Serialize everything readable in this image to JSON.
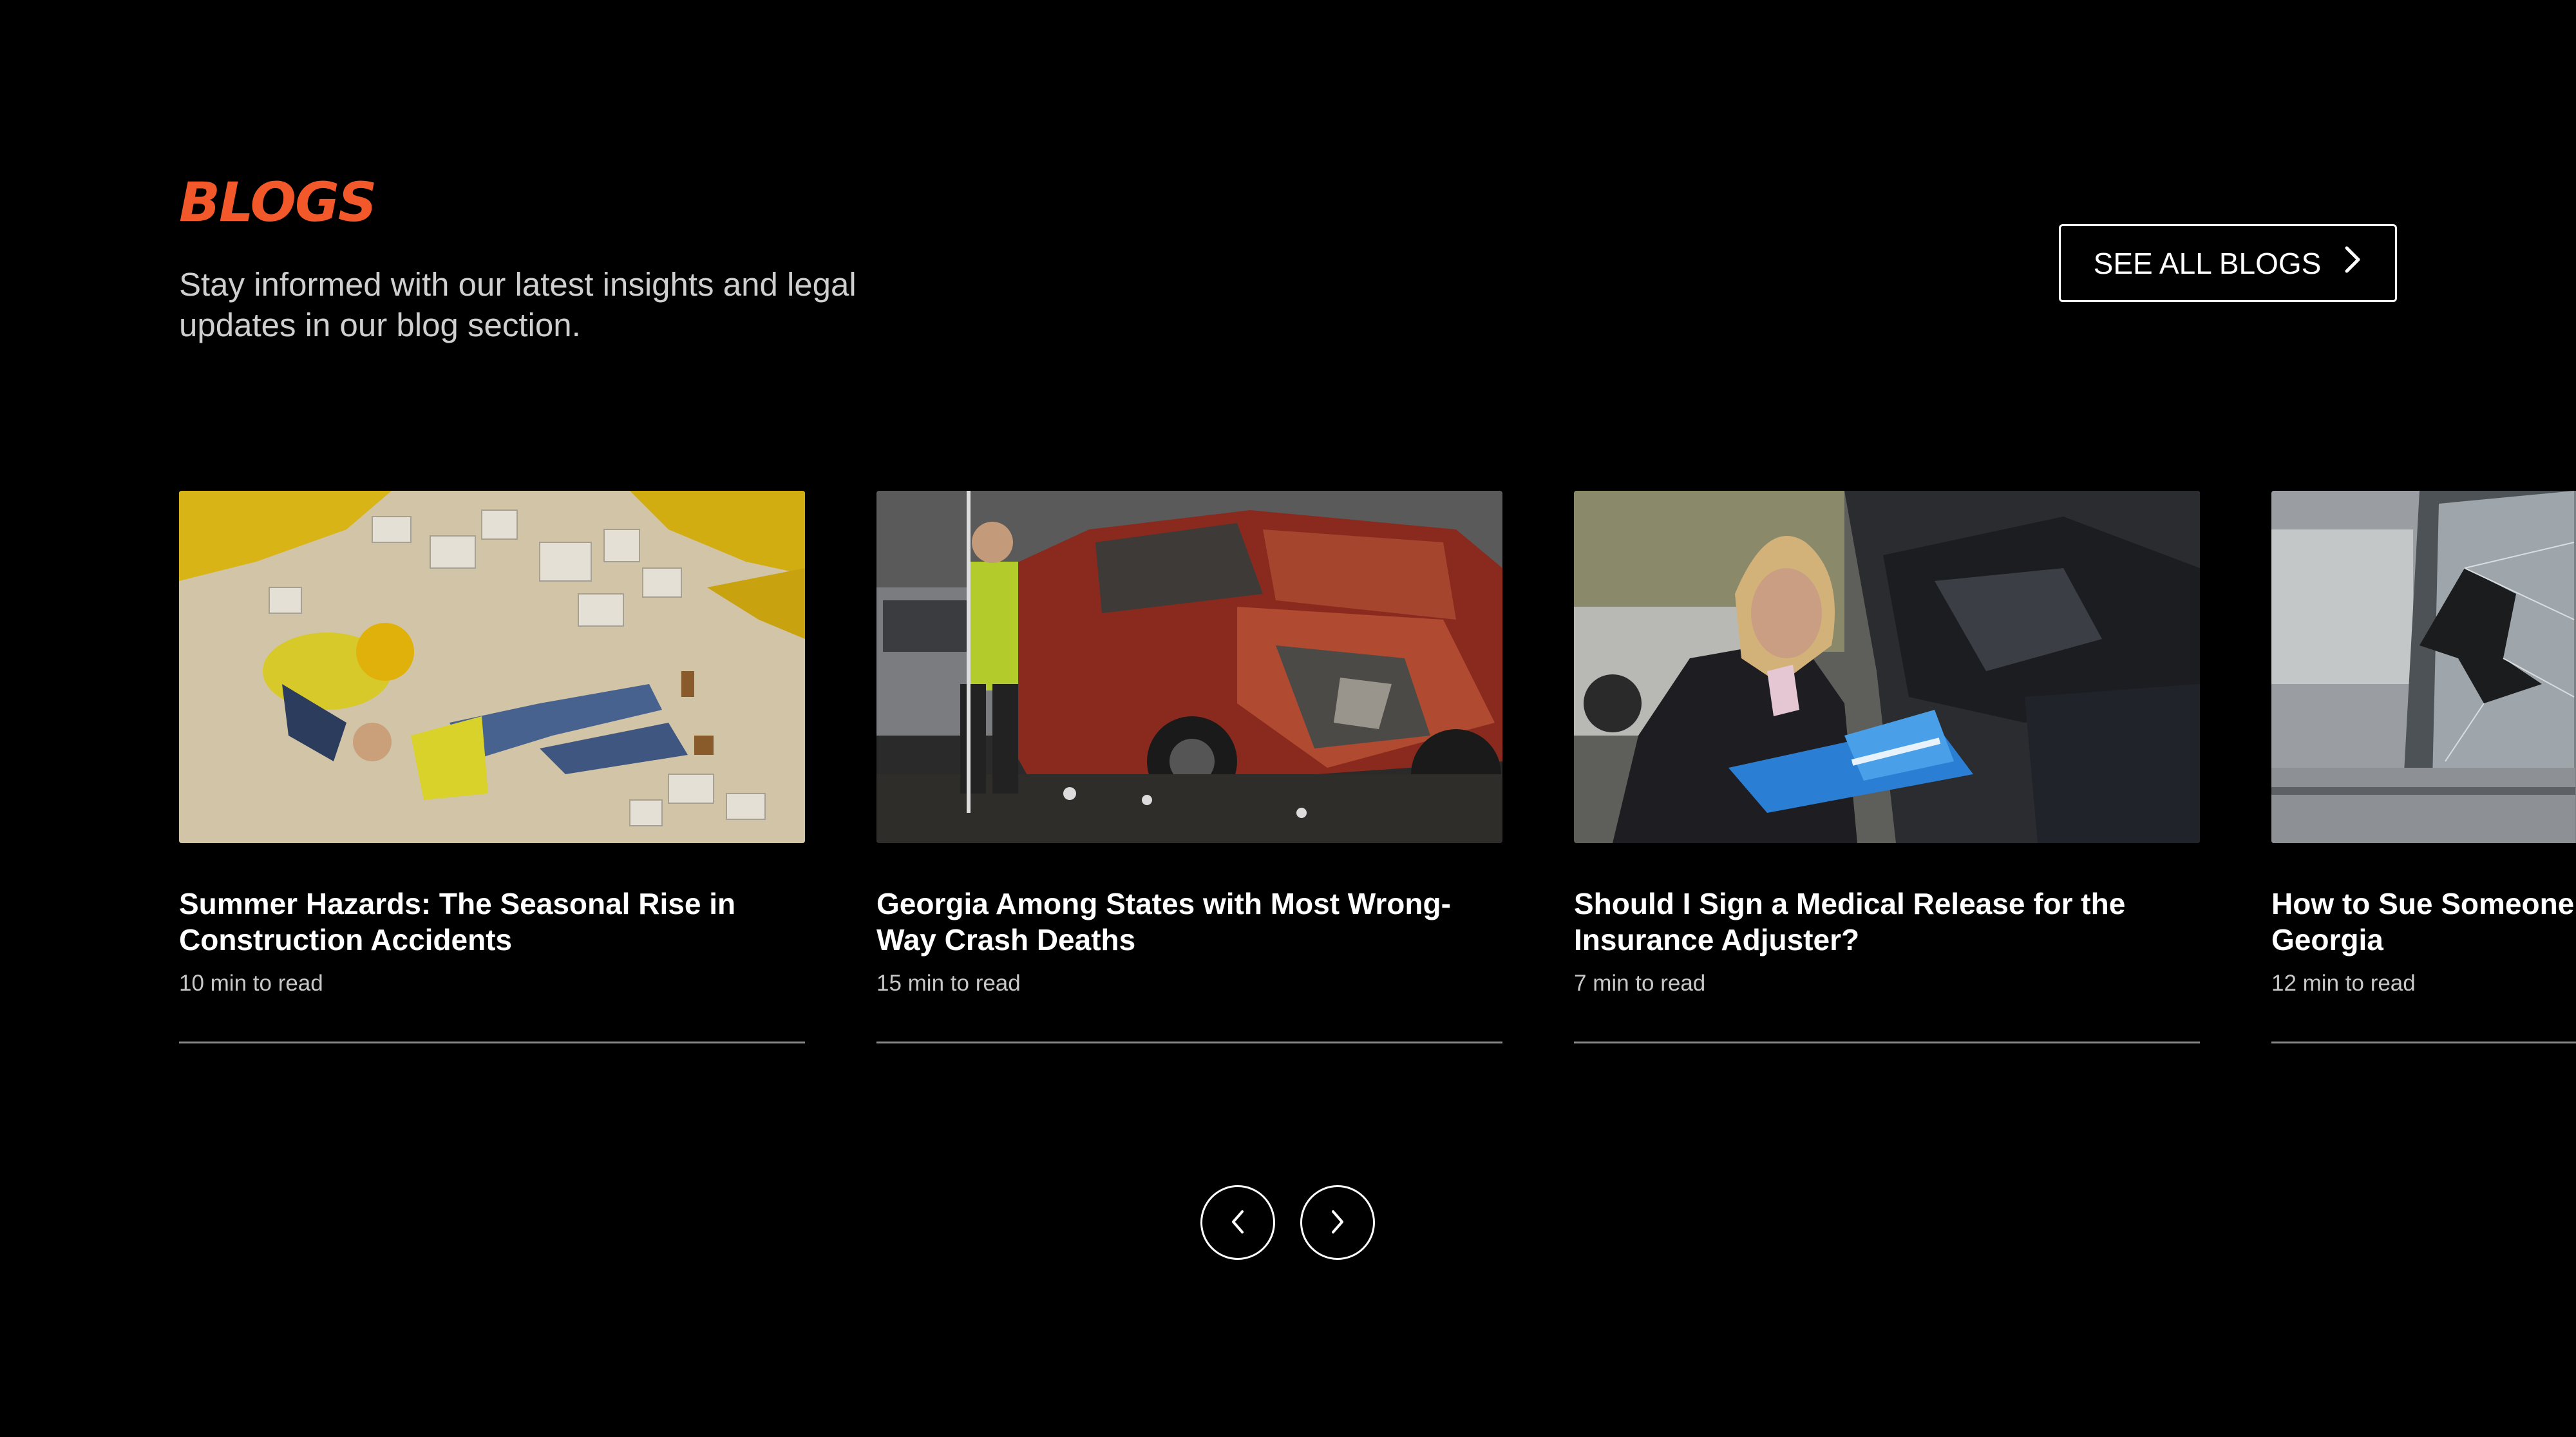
{
  "section": {
    "title": "BLOGS",
    "subtitle": "Stay informed with our latest insights and legal updates in our blog section.",
    "see_all_label": "SEE ALL BLOGS"
  },
  "colors": {
    "accent": "#f2582a",
    "background": "#000000",
    "text": "#ffffff",
    "muted_text": "#cfcfcf"
  },
  "icons": {
    "see_all": "chevron-right-icon",
    "prev": "chevron-left-icon",
    "next": "chevron-right-icon"
  },
  "cards": [
    {
      "title": "Summer Hazards: The Seasonal Rise in Construction Accidents",
      "read_time": "10 min to read",
      "image": "construction-accident-photo"
    },
    {
      "title": "Georgia Among States with Most Wrong-Way Crash Deaths",
      "read_time": "15 min to read",
      "image": "wrecked-red-car-photo"
    },
    {
      "title": "Should I Sign a Medical Release for the Insurance Adjuster?",
      "read_time": "7 min to read",
      "image": "adjuster-inspecting-car-photo"
    },
    {
      "title": "How to Sue Someone for a Car Accident in Georgia",
      "read_time": "12 min to read",
      "image": "broken-car-window-photo"
    }
  ]
}
